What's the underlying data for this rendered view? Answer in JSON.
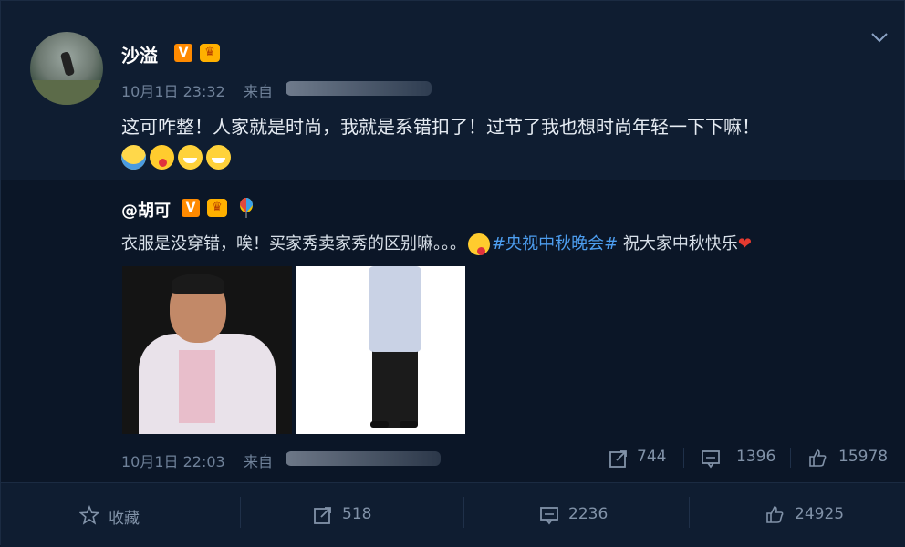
{
  "post": {
    "username": "沙溢",
    "timestamp": "10月1日 23:32",
    "source_prefix": "来自",
    "text": "这可咋整！人家就是时尚，我就是系错扣了！过节了我也想时尚年轻一下下嘛！",
    "emojis": [
      "laughing-crying-emoji",
      "tongue-emoji",
      "grin-emoji",
      "grin-emoji"
    ]
  },
  "repost": {
    "username": "@胡可",
    "text_before": "衣服是没穿错，唉！买家秀卖家秀的区别嘛。。。",
    "hashtag": "#央视中秋晚会#",
    "text_after": " 祝大家中秋快乐",
    "heart": "❤",
    "timestamp": "10月1日 22:03",
    "source_prefix": "来自",
    "stats": {
      "reposts": "744",
      "comments": "1396",
      "likes": "15978"
    }
  },
  "footer": {
    "favorite_label": "收藏",
    "reposts": "518",
    "comments": "2236",
    "likes": "24925"
  },
  "colors": {
    "background": "#0f1d31",
    "accent_link": "#4d9ef0",
    "vip_badge": "#ff8a00"
  }
}
